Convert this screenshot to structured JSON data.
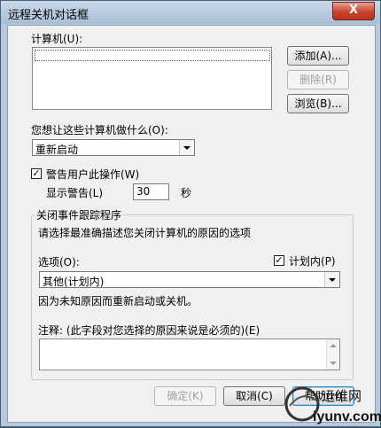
{
  "window": {
    "title": "远程关机对话框",
    "close_glyph": "X"
  },
  "computers": {
    "label": "计算机(U):",
    "add_button": "添加(A)...",
    "remove_button": "删除(R)",
    "browse_button": "浏览(B)..."
  },
  "action": {
    "label": "您想让这些计算机做什么(O):",
    "selected": "重新启动"
  },
  "warning": {
    "checkbox_label": "警告用户此操作(W)",
    "checked": true,
    "display_label": "显示警告(L)",
    "seconds_value": "30",
    "seconds_unit": "秒"
  },
  "tracker": {
    "group_label": "关闭事件跟踪程序",
    "instruction": "请选择最准确描述您关闭计算机的原因的选项",
    "option_label": "选项(O):",
    "planned_label": "计划内(P)",
    "planned_checked": true,
    "option_selected": "其他(计划内)",
    "description": "因为未知原因而重新启动或关机。",
    "comment_label": "注释: (此字段对您选择的原因来说是必须的)(E)",
    "comment_value": ""
  },
  "footer": {
    "ok_button": "确定(K)",
    "cancel_button": "取消(C)",
    "help_button": "帮助(H)"
  },
  "watermark": {
    "text_cn": "运维网",
    "text_en": "iyunv.com"
  },
  "colors": {
    "titlebar": "#b7c9dc",
    "client": "#f0f0f0",
    "close_button": "#c8442f"
  }
}
